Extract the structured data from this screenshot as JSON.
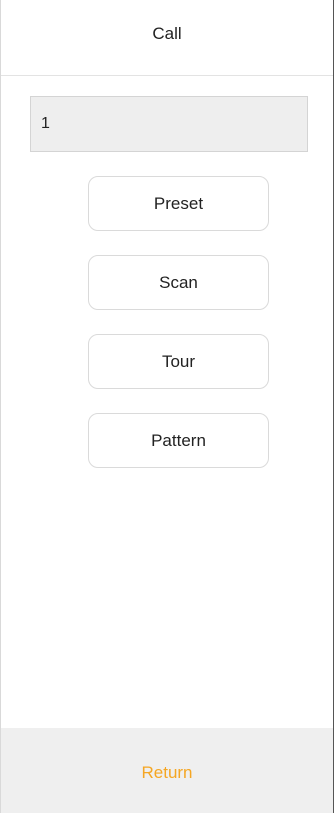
{
  "header": {
    "title": "Call"
  },
  "input": {
    "value": "1"
  },
  "buttons": [
    {
      "label": "Preset"
    },
    {
      "label": "Scan"
    },
    {
      "label": "Tour"
    },
    {
      "label": "Pattern"
    }
  ],
  "footer": {
    "return_label": "Return"
  },
  "colors": {
    "accent": "#f5a623",
    "footer_bg": "#efefef",
    "input_bg": "#eeeeee"
  }
}
